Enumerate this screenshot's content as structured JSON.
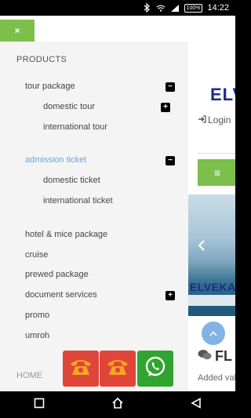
{
  "status_bar": {
    "time": "14:22",
    "battery": "100%"
  },
  "drawer": {
    "close_label": "×",
    "section_title": "PRODUCTS",
    "items": [
      {
        "label": "tour package",
        "toggle": "−"
      },
      {
        "label": "domestic tour",
        "toggle": "+"
      },
      {
        "label": "international tour"
      },
      {
        "label": "admission ticket",
        "toggle": "−"
      },
      {
        "label": "domestic ticket"
      },
      {
        "label": "international ticket"
      },
      {
        "label": "hotel & mice package"
      },
      {
        "label": "cruise"
      },
      {
        "label": "prewed package"
      },
      {
        "label": "document services",
        "toggle": "+"
      },
      {
        "label": "promo"
      },
      {
        "label": "umroh"
      }
    ],
    "home_label": "HOME"
  },
  "content": {
    "logo_text": "ELVE",
    "login_label": "Login",
    "menu_icon": "≡",
    "banner_brand": "ELVEKA",
    "section_title": "FL",
    "section_sub": "Added val"
  },
  "colors": {
    "accent_green": "#7cbf4a",
    "active_blue": "#6aa6d8",
    "phone_red": "#e0453a",
    "whatsapp_green": "#2fa52f"
  }
}
